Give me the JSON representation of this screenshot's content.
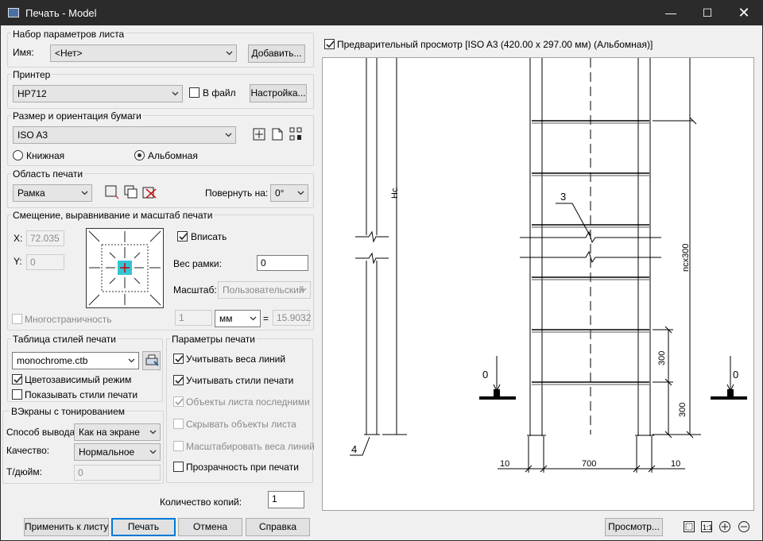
{
  "window": {
    "title": "Печать - Model"
  },
  "page_setup": {
    "legend": "Набор параметров листа",
    "name_label": "Имя:",
    "name_value": "<Нет>",
    "add_button": "Добавить..."
  },
  "printer": {
    "legend": "Принтер",
    "value": "HP712",
    "to_file_label": "В файл",
    "settings_button": "Настройка..."
  },
  "paper": {
    "legend": "Размер и ориентация бумаги",
    "value": "ISO A3",
    "portrait_label": "Книжная",
    "landscape_label": "Альбомная"
  },
  "plot_area": {
    "legend": "Область печати",
    "value": "Рамка",
    "rotate_label": "Повернуть на:",
    "rotate_value": "0°"
  },
  "offset": {
    "legend": "Смещение, выравнивание и масштаб печати",
    "x_label": "X:",
    "x_value": "72.035",
    "y_label": "Y:",
    "y_value": "0",
    "fit_label": "Вписать",
    "frame_weight_label": "Вес рамки:",
    "frame_weight_value": "0",
    "scale_label": "Масштаб:",
    "scale_value": "Пользовательский",
    "scale_num": "1",
    "unit_value": "мм",
    "equals": "=",
    "scale_den": "15.9032",
    "multipage_label": "Многостраничность"
  },
  "style_table": {
    "legend": "Таблица стилей печати",
    "value": "monochrome.ctb",
    "color_dependent_label": "Цветозависимый режим",
    "show_styles_label": "Показывать стили печати"
  },
  "shaded": {
    "legend": "ВЭкраны с тонированием",
    "output_label": "Способ вывода:",
    "output_value": "Как на экране",
    "quality_label": "Качество:",
    "quality_value": "Нормальное",
    "dpi_label": "Т/дюйм:",
    "dpi_value": "0"
  },
  "print_options": {
    "legend": "Параметры печати",
    "items": [
      {
        "label": "Учитывать веса линий",
        "checked": true,
        "disabled": false
      },
      {
        "label": "Учитывать стили печати",
        "checked": true,
        "disabled": false
      },
      {
        "label": "Объекты листа последними",
        "checked": true,
        "disabled": true
      },
      {
        "label": "Скрывать объекты листа",
        "checked": false,
        "disabled": true
      },
      {
        "label": "Масштабировать веса линий",
        "checked": false,
        "disabled": true
      },
      {
        "label": "Прозрачность при печати",
        "checked": false,
        "disabled": false
      }
    ]
  },
  "copies": {
    "label": "Количество копий:",
    "value": "1"
  },
  "buttons": {
    "apply": "Применить к листу",
    "print": "Печать",
    "cancel": "Отмена",
    "help": "Справка",
    "preview": "Просмотр..."
  },
  "preview_header": "Предварительный просмотр [ISO A3 (420.00 x 297.00 мм) (Альбомная)]",
  "drawing": {
    "hc": "Hc",
    "ncx300": "ncx300",
    "d300a": "300",
    "d300b": "300",
    "dim10a": "10",
    "dim700": "700",
    "dim10b": "10",
    "callout3": "3",
    "callout4": "4",
    "zero_left": "0",
    "zero_right": "0"
  }
}
